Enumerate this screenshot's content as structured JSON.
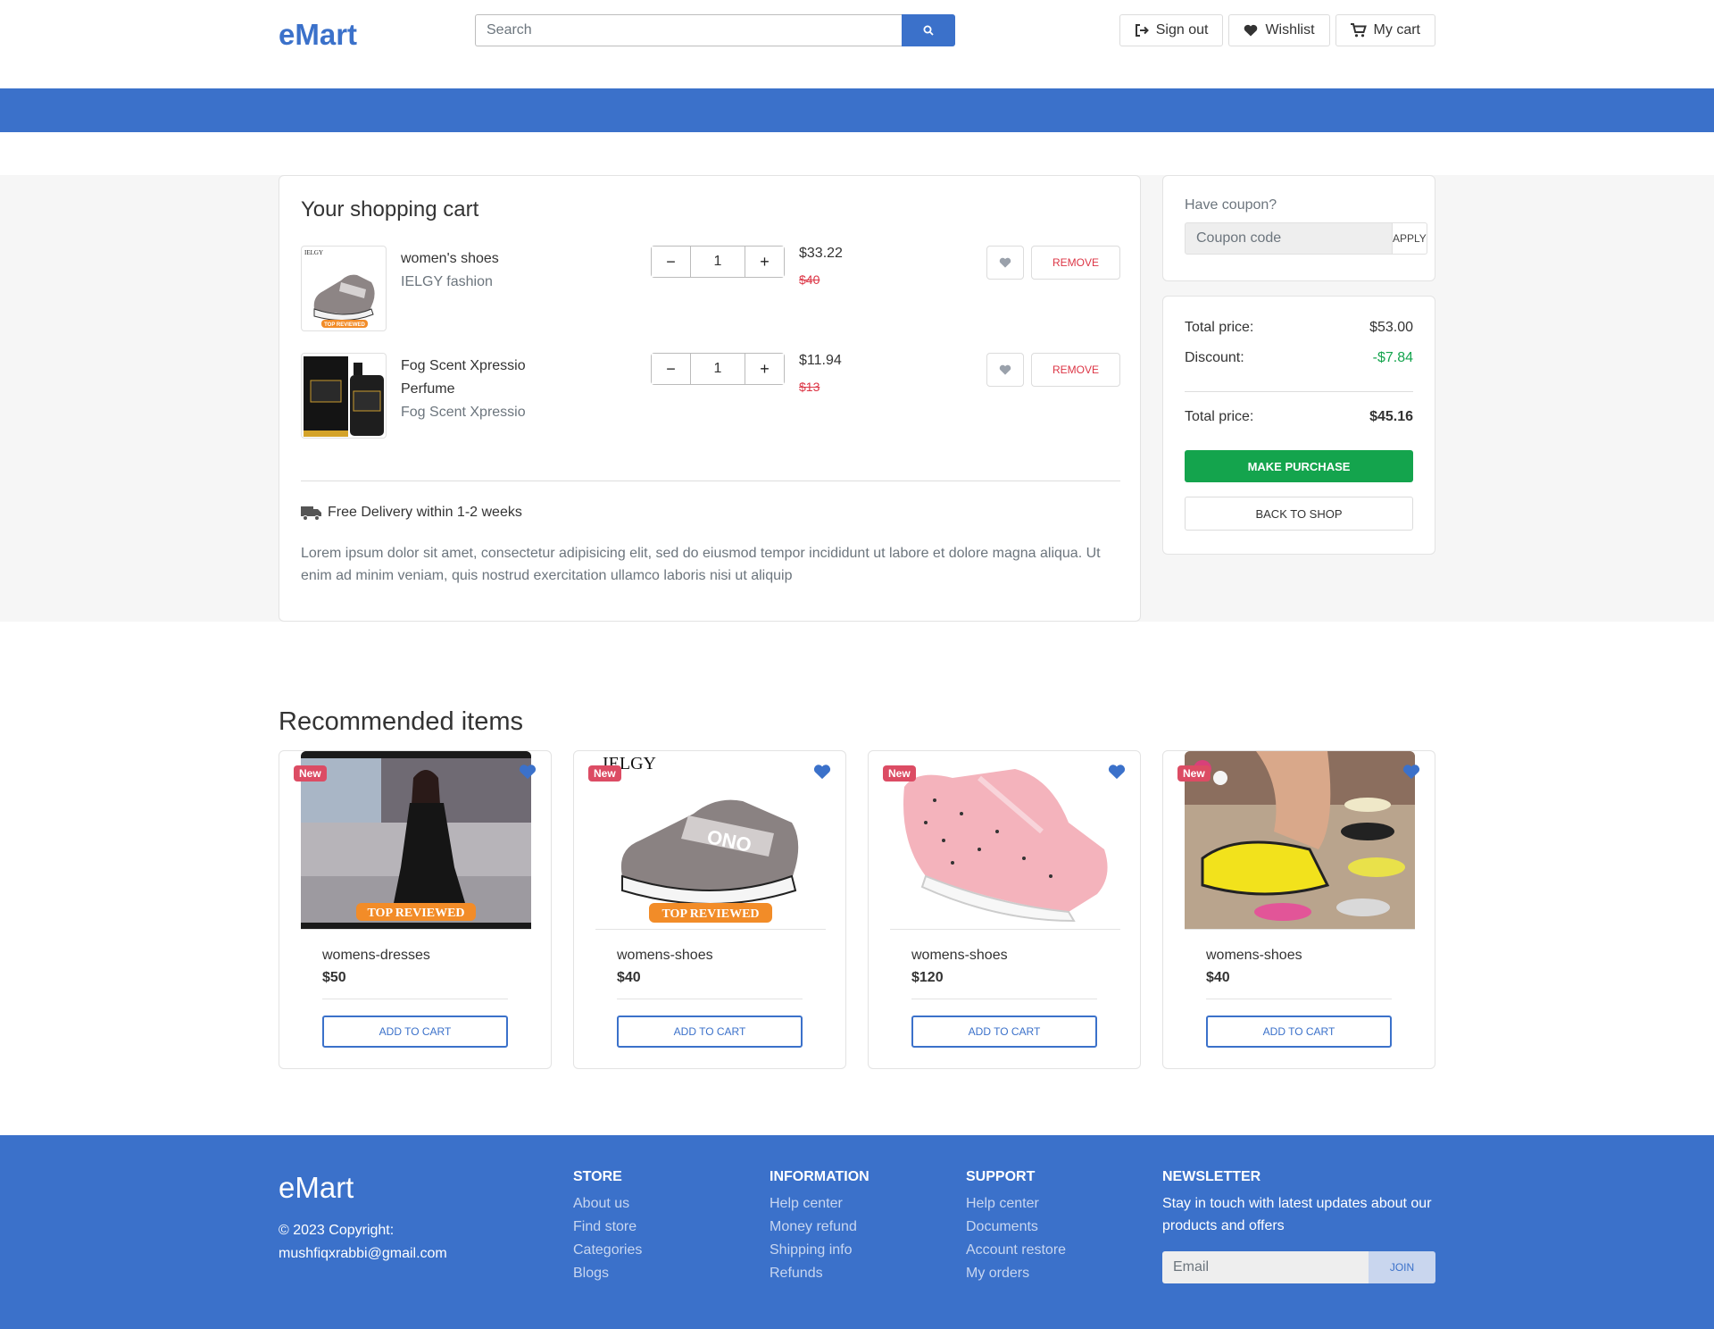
{
  "header": {
    "logo": "eMart",
    "search_placeholder": "Search",
    "sign_out": "Sign out",
    "wishlist": "Wishlist",
    "my_cart": "My cart"
  },
  "cart": {
    "title": "Your shopping cart",
    "items": [
      {
        "name": "women's shoes",
        "brand": "IELGY fashion",
        "qty": "1",
        "price": "$33.22",
        "old_price": "$40",
        "remove": "REMOVE"
      },
      {
        "name": "Fog Scent Xpressio Perfume",
        "brand": "Fog Scent Xpressio",
        "qty": "1",
        "price": "$11.94",
        "old_price": "$13",
        "remove": "REMOVE"
      }
    ],
    "delivery": "Free Delivery within 1-2 weeks",
    "description": "Lorem ipsum dolor sit amet, consectetur adipisicing elit, sed do eiusmod tempor incididunt ut labore et dolore magna aliqua. Ut enim ad minim veniam, quis nostrud exercitation ullamco laboris nisi ut aliquip"
  },
  "coupon": {
    "label": "Have coupon?",
    "placeholder": "Coupon code",
    "apply": "APPLY"
  },
  "summary": {
    "total_label": "Total price:",
    "total_value": "$53.00",
    "discount_label": "Discount:",
    "discount_value": "-$7.84",
    "final_label": "Total price:",
    "final_value": "$45.16",
    "purchase": "MAKE PURCHASE",
    "back": "BACK TO SHOP"
  },
  "recommended": {
    "title": "Recommended items",
    "items": [
      {
        "badge": "New",
        "name": "womens-dresses",
        "price": "$50",
        "button": "ADD TO CART"
      },
      {
        "badge": "New",
        "name": "womens-shoes",
        "price": "$40",
        "button": "ADD TO CART"
      },
      {
        "badge": "New",
        "name": "womens-shoes",
        "price": "$120",
        "button": "ADD TO CART"
      },
      {
        "badge": "New",
        "name": "womens-shoes",
        "price": "$40",
        "button": "ADD TO CART"
      }
    ],
    "image_texts": {
      "top_reviewed": "TOP REVIEWED",
      "brand": "IELGY",
      "shoe_mark": "ONO"
    }
  },
  "footer": {
    "logo": "eMart",
    "copyright": "© 2023 Copyright:",
    "email": "mushfiqxrabbi@gmail.com",
    "store": {
      "title": "STORE",
      "links": [
        "About us",
        "Find store",
        "Categories",
        "Blogs"
      ]
    },
    "information": {
      "title": "INFORMATION",
      "links": [
        "Help center",
        "Money refund",
        "Shipping info",
        "Refunds"
      ]
    },
    "support": {
      "title": "SUPPORT",
      "links": [
        "Help center",
        "Documents",
        "Account restore",
        "My orders"
      ]
    },
    "newsletter": {
      "title": "NEWSLETTER",
      "text": "Stay in touch with latest updates about our products and offers",
      "placeholder": "Email",
      "join": "JOIN"
    }
  },
  "colors": {
    "primary": "#3b71ca",
    "success": "#14a44d",
    "danger": "#dc3545",
    "badge": "#dc4c64"
  },
  "icons": {
    "search": "search-icon",
    "sign_out": "sign-out-icon",
    "wishlist": "heart-icon",
    "cart": "cart-icon",
    "delivery": "truck-icon"
  }
}
